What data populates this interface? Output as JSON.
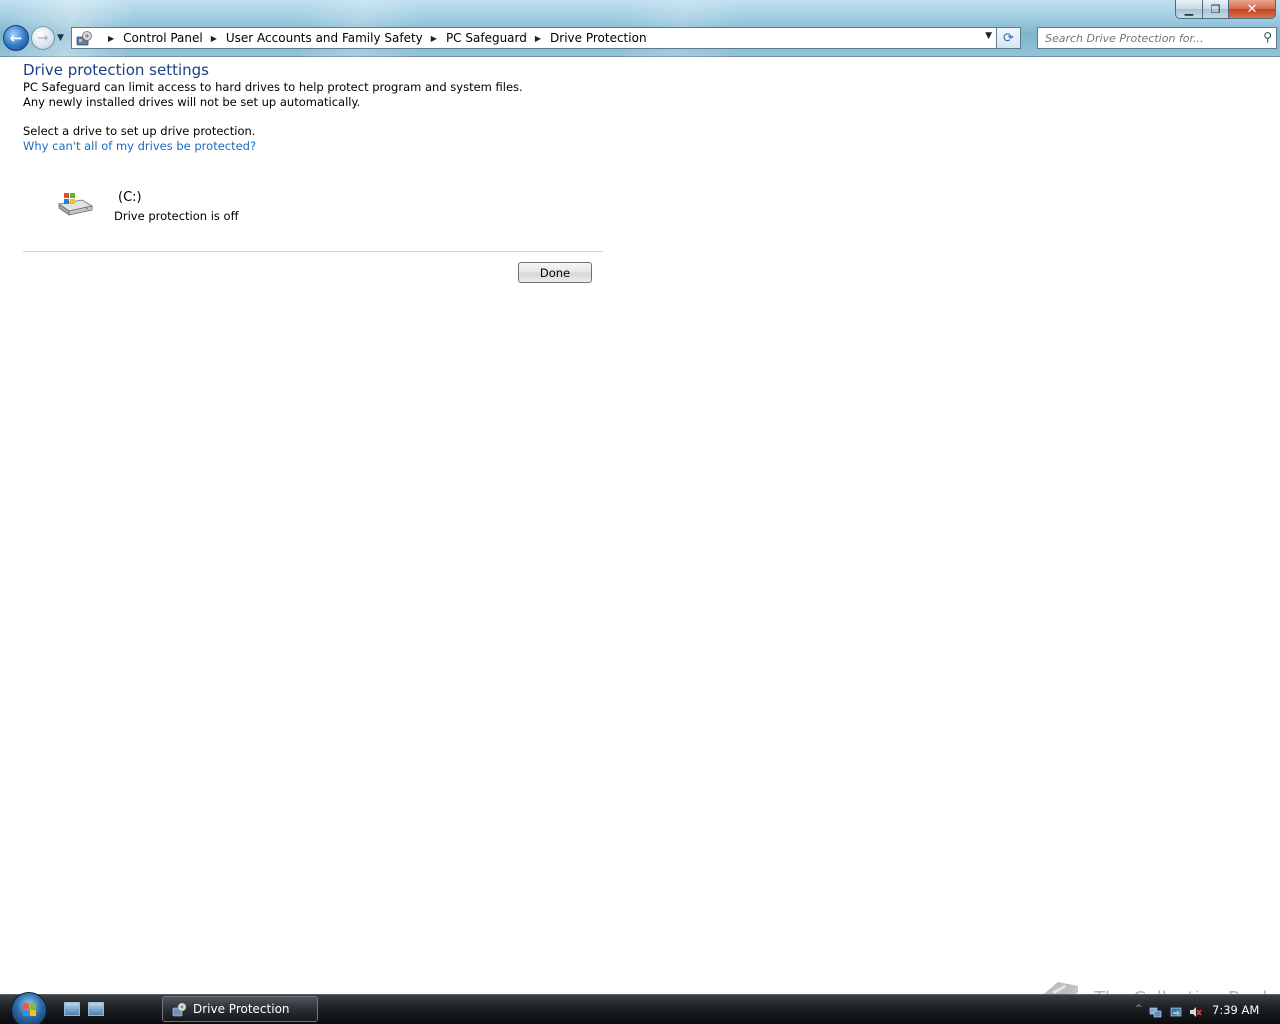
{
  "window": {
    "minimize_glyph": "▁",
    "maximize_glyph": "❐",
    "close_glyph": "✕"
  },
  "nav": {
    "back_glyph": "←",
    "forward_glyph": "→",
    "dropdown_glyph": "▼",
    "breadcrumb": [
      "Control Panel",
      "User Accounts and Family Safety",
      "PC Safeguard",
      "Drive Protection"
    ],
    "breadcrumb_separator": "▶",
    "refresh_glyph": "⟳",
    "search_placeholder": "Search Drive Protection for...",
    "search_glyph": "⚲"
  },
  "content": {
    "title": "Drive protection settings",
    "description_line1": "PC Safeguard can limit access to hard drives to help protect program and system files.",
    "description_line2": "Any newly installed drives will not be set up automatically.",
    "select_prompt": "Select a drive to set up drive protection.",
    "help_link": "Why can't all of my drives be protected?",
    "drive": {
      "name": "(C:)",
      "status": "Drive protection is off",
      "icon": "hard-drive-windows-icon"
    },
    "done_label": "Done"
  },
  "watermark": {
    "text": "The Collection Book"
  },
  "taskbar": {
    "task_label": "Drive Protection",
    "tray_chevron": "^",
    "clock": "7:39 AM"
  },
  "colors": {
    "title_blue": "#1e3f85",
    "link_blue": "#1b6ac2",
    "chrome_blue": "#9ecbe0",
    "taskbar_black": "#1d2125"
  }
}
